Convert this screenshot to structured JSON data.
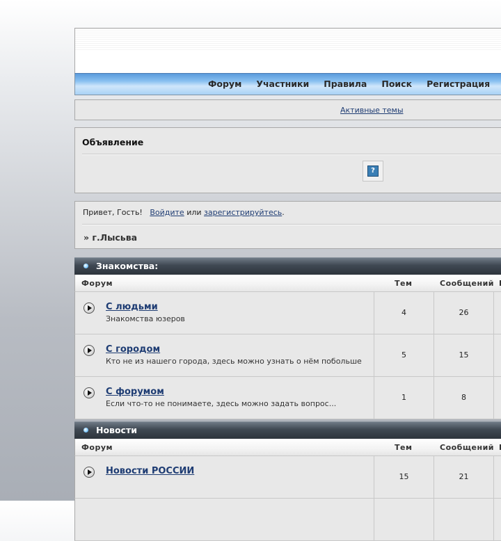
{
  "nav": {
    "items": [
      {
        "label": "Форум"
      },
      {
        "label": "Участники"
      },
      {
        "label": "Правила"
      },
      {
        "label": "Поиск"
      },
      {
        "label": "Регистрация"
      }
    ]
  },
  "active_topics": "Активные темы",
  "announcement": {
    "title": "Объявление",
    "help_icon": "help-question-icon",
    "help_glyph": "?"
  },
  "guest": {
    "greeting": "Привет, Гость!",
    "login_link": "Войдите",
    "or": "или",
    "register_link": "зарегистрируйтесь",
    "period": ".",
    "breadcrumb": "» г.Лысьва"
  },
  "table_headers": {
    "forum": "Форум",
    "topics": "Тем",
    "posts": "Сообщений",
    "last": "П"
  },
  "categories": [
    {
      "name": "Знакомства:",
      "forums": [
        {
          "name": "С людьми",
          "desc": "Знакомства юзеров",
          "topics": "4",
          "posts": "26"
        },
        {
          "name": "С городом",
          "desc": "Кто не из нашего города, здесь можно узнать о нём побольше",
          "topics": "5",
          "posts": "15"
        },
        {
          "name": "С форумом",
          "desc": "Если что-то не понимаете, здесь можно задать вопрос...",
          "topics": "1",
          "posts": "8"
        }
      ]
    },
    {
      "name": "Новости",
      "forums": [
        {
          "name": "Новости РОССИИ",
          "desc": "",
          "topics": "15",
          "posts": "21"
        }
      ]
    }
  ],
  "colors": {
    "link": "#1e3c73",
    "category_bar": "#3f4852",
    "nav_blue": "#88c0f0"
  }
}
